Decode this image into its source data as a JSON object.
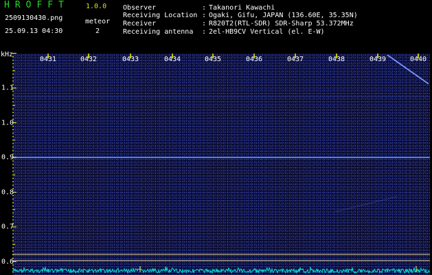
{
  "app": {
    "title": "HROFFT",
    "version": "1.0.0",
    "file_name": "2509130430.png",
    "timestamp": "25.09.13 04:30",
    "meteor_label": "meteor",
    "meteor_count": "2"
  },
  "station_info": [
    {
      "label": "Observer",
      "value": "Takanori Kawachi"
    },
    {
      "label": "Receiving Location",
      "value": "Ogaki, Gifu, JAPAN (136.60E, 35.35N)"
    },
    {
      "label": "Receiver",
      "value": "R820T2(RTL-SDR) SDR-Sharp 53.372MHz"
    },
    {
      "label": "Receiving antenna",
      "value": "2el-HB9CV Vertical (el. E-W)"
    }
  ],
  "spectrogram": {
    "frequency_unit": "kHz",
    "time_ticks": [
      "0431",
      "0432",
      "0433",
      "0434",
      "0435",
      "0436",
      "0437",
      "0438",
      "0439",
      "0440"
    ],
    "frequency_ticks": [
      "1.1",
      "1.0",
      "0.9",
      "0.8",
      "0.7",
      "0.6"
    ],
    "frequency_range_khz": [
      0.57,
      1.2
    ],
    "carrier_frequency_khz": 0.9,
    "colors": {
      "background": "#0a0a2a",
      "carrier": "#3a7bff",
      "ticks": "#ffff00",
      "text": "#ffffff",
      "title": "#22dd22",
      "version": "#dddd22",
      "noise_floor": "#00e5e5",
      "reference_line": "#e8d9a8"
    }
  }
}
